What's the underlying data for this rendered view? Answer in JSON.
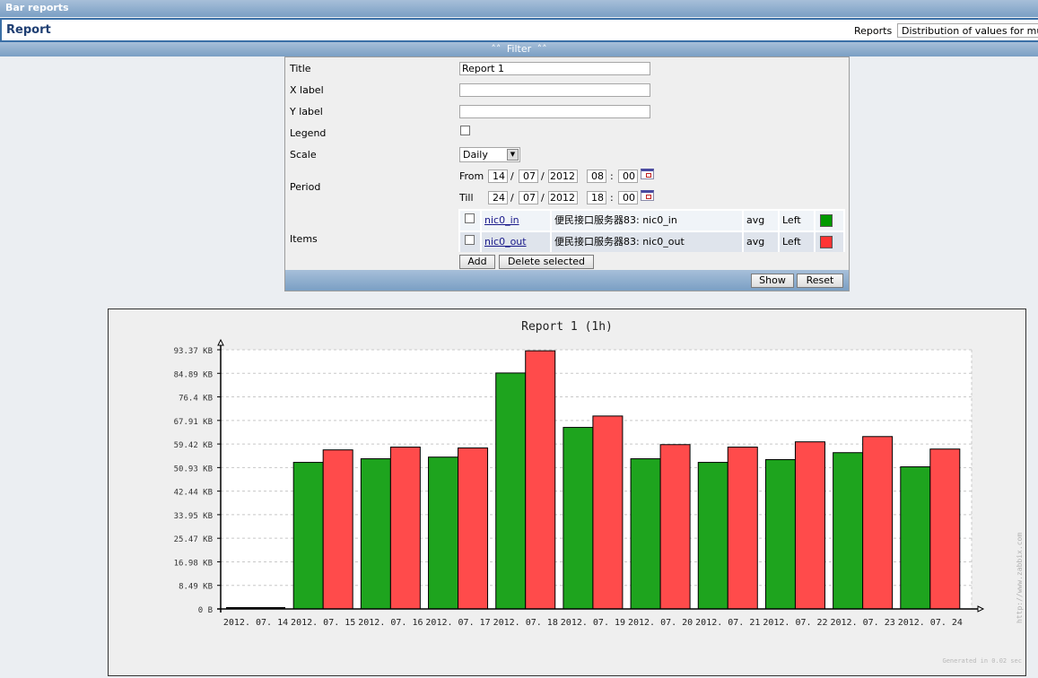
{
  "header": {
    "title": "Bar reports"
  },
  "report_bar": {
    "title": "Report",
    "reports_label": "Reports",
    "reports_selected": "Distribution of values for multiple periods"
  },
  "filter": {
    "toggle_label": "» Filter »",
    "toggle_icon": "double-chevron-up",
    "labels": {
      "title": "Title",
      "xlabel": "X label",
      "ylabel": "Y label",
      "legend": "Legend",
      "scale": "Scale",
      "period": "Period",
      "items": "Items",
      "from": "From",
      "till": "Till"
    },
    "values": {
      "title": "Report 1",
      "xlabel": "",
      "ylabel": "",
      "legend_checked": false,
      "scale": "Daily"
    },
    "from": {
      "day": "14",
      "month": "07",
      "year": "2012",
      "hour": "08",
      "minute": "00"
    },
    "till": {
      "day": "24",
      "month": "07",
      "year": "2012",
      "hour": "18",
      "minute": "00"
    },
    "date_sep": "/",
    "time_sep": ":",
    "items": [
      {
        "key": "nic0_in",
        "description": "便民接口服务器83: nic0_in",
        "function": "avg",
        "axis": "Left",
        "color": "#009900"
      },
      {
        "key": "nic0_out",
        "description": "便民接口服务器83: nic0_out",
        "function": "avg",
        "axis": "Left",
        "color": "#ff3333"
      }
    ],
    "buttons": {
      "add": "Add",
      "delete_selected": "Delete selected",
      "show": "Show",
      "reset": "Reset"
    }
  },
  "chart_data": {
    "type": "bar",
    "title": "Report 1 (1h)",
    "xlabel": "",
    "ylabel": "",
    "categories": [
      "2012.07.14",
      "2012.07.15",
      "2012.07.16",
      "2012.07.17",
      "2012.07.18",
      "2012.07.19",
      "2012.07.20",
      "2012.07.21",
      "2012.07.22",
      "2012.07.23",
      "2012.07.24"
    ],
    "series": [
      {
        "name": "nic0_in",
        "color": "#1ea41e",
        "values": [
          0,
          52.8,
          54.1,
          54.7,
          85.0,
          65.4,
          54.1,
          52.8,
          53.8,
          56.3,
          51.2
        ]
      },
      {
        "name": "nic0_out",
        "color": "#ff4b4b",
        "values": [
          0,
          57.3,
          58.3,
          58.0,
          93.0,
          69.5,
          59.2,
          58.3,
          60.2,
          62.1,
          57.6
        ]
      }
    ],
    "unit": "KB",
    "ylim": [
      0,
      93.37
    ],
    "yticks": [
      "0 B",
      "8.49 KB",
      "16.98 KB",
      "25.47 KB",
      "33.95 KB",
      "42.44 KB",
      "50.93 KB",
      "59.42 KB",
      "67.91 KB",
      "76.4 KB",
      "84.89 KB",
      "93.37 KB"
    ],
    "grid": true,
    "legend": "none",
    "watermark": "http://www.zabbix.com",
    "footer": "Generated in 0.02 sec"
  }
}
